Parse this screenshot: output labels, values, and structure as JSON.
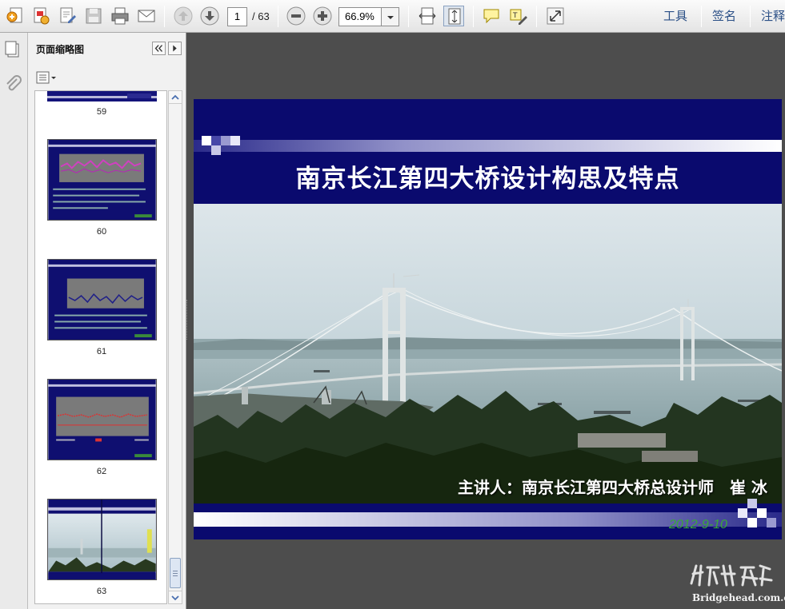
{
  "toolbar": {
    "page_current": "1",
    "page_total": "/ 63",
    "zoom": "66.9%",
    "tools_label": "工具",
    "sign_label": "签名",
    "comment_label": "注释"
  },
  "panel": {
    "title": "页面缩略图"
  },
  "thumbnails": [
    {
      "page": "59"
    },
    {
      "page": "60"
    },
    {
      "page": "61"
    },
    {
      "page": "62"
    },
    {
      "page": "63"
    }
  ],
  "slide": {
    "title": "南京长江第四大桥设计构思及特点",
    "presenter": "主讲人：南京长江第四大桥总设计师　崔 冰",
    "date": "2012-9-10"
  },
  "watermark": {
    "text": "Bridgehead.com.cn"
  },
  "colors": {
    "slide_navy": "#0a0a6e",
    "date_green": "#3aa83a",
    "toolbar_label": "#2a4f86"
  }
}
